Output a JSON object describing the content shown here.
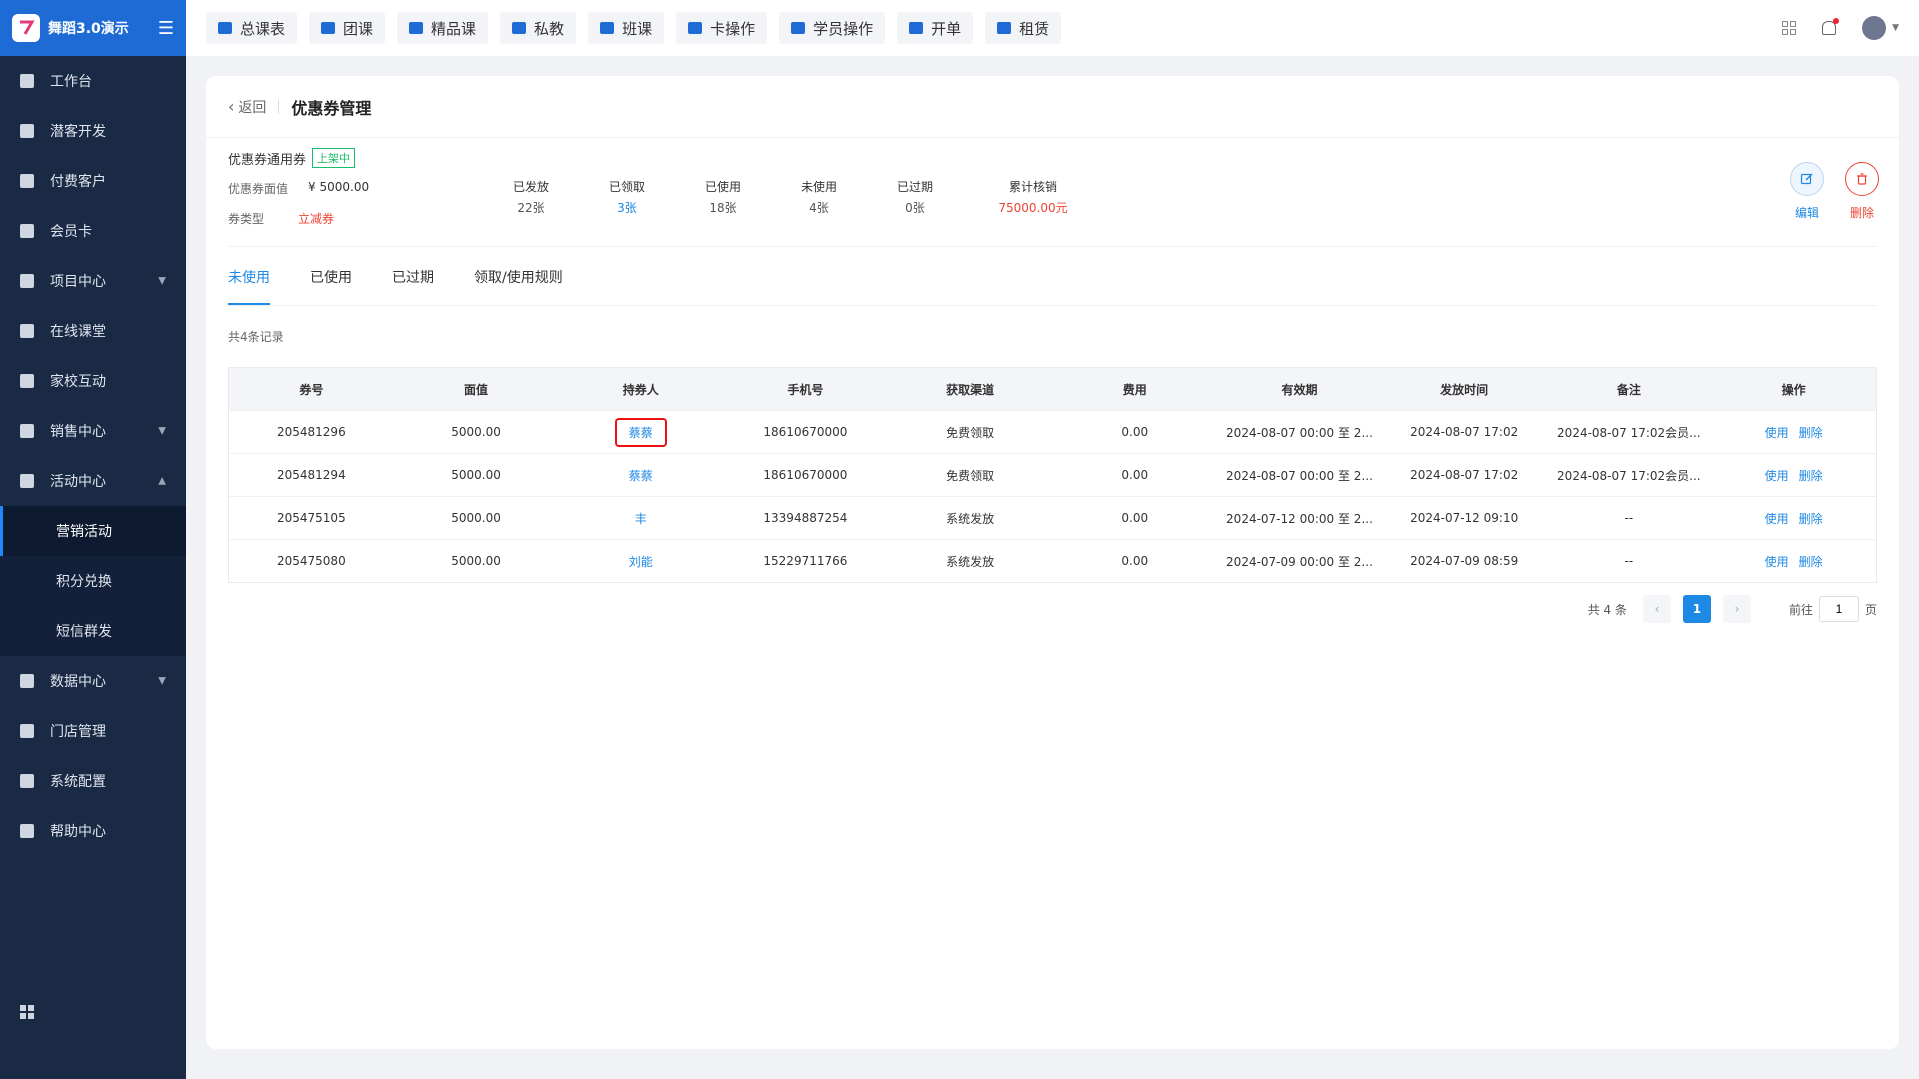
{
  "app": {
    "title": "舞蹈3.0演示"
  },
  "sidebar": {
    "items": [
      {
        "label": "工作台",
        "icon": "monitor-icon"
      },
      {
        "label": "潜客开发",
        "icon": "id-card-icon"
      },
      {
        "label": "付费客户",
        "icon": "users-icon"
      },
      {
        "label": "会员卡",
        "icon": "card-icon"
      },
      {
        "label": "项目中心",
        "icon": "folder-icon"
      },
      {
        "label": "在线课堂",
        "icon": "video-icon"
      },
      {
        "label": "家校互动",
        "icon": "book-icon"
      },
      {
        "label": "销售中心",
        "icon": "tag-icon"
      },
      {
        "label": "活动中心",
        "icon": "calendar-icon"
      }
    ],
    "sub_items": [
      {
        "label": "营销活动"
      },
      {
        "label": "积分兑换"
      },
      {
        "label": "短信群发"
      }
    ],
    "items_after": [
      {
        "label": "数据中心",
        "icon": "pie-chart-icon"
      },
      {
        "label": "门店管理",
        "icon": "store-icon"
      },
      {
        "label": "系统配置",
        "icon": "settings-icon"
      },
      {
        "label": "帮助中心",
        "icon": "help-icon"
      }
    ]
  },
  "topbar": {
    "tabs": [
      {
        "label": "总课表"
      },
      {
        "label": "团课"
      },
      {
        "label": "精品课"
      },
      {
        "label": "私教"
      },
      {
        "label": "班课"
      },
      {
        "label": "卡操作"
      },
      {
        "label": "学员操作"
      },
      {
        "label": "开单"
      },
      {
        "label": "租赁"
      }
    ]
  },
  "header": {
    "back_label": "返回",
    "title": "优惠券管理"
  },
  "coupon": {
    "name": "优惠券通用券",
    "status": "上架中",
    "value_label": "优惠券面值",
    "value": "¥ 5000.00",
    "type_label": "券类型",
    "type": "立减券",
    "stats": [
      {
        "label": "已发放",
        "value": "22张"
      },
      {
        "label": "已领取",
        "value": "3张"
      },
      {
        "label": "已使用",
        "value": "18张"
      },
      {
        "label": "未使用",
        "value": "4张"
      },
      {
        "label": "已过期",
        "value": "0张"
      },
      {
        "label": "累计核销",
        "value": "75000.00元"
      }
    ],
    "edit_label": "编辑",
    "delete_label": "删除"
  },
  "tabs": [
    {
      "label": "未使用"
    },
    {
      "label": "已使用"
    },
    {
      "label": "已过期"
    },
    {
      "label": "领取/使用规则"
    }
  ],
  "record_count": "共4条记录",
  "table": {
    "columns": [
      "券号",
      "面值",
      "持券人",
      "手机号",
      "获取渠道",
      "费用",
      "有效期",
      "发放时间",
      "备注",
      "操作"
    ],
    "rows": [
      {
        "code": "205481296",
        "value": "5000.00",
        "holder": "蔡蔡",
        "phone": "18610670000",
        "channel": "免费领取",
        "fee": "0.00",
        "validity": "2024-08-07 00:00 至 2...",
        "issued": "2024-08-07 17:02",
        "note": "2024-08-07 17:02会员..."
      },
      {
        "code": "205481294",
        "value": "5000.00",
        "holder": "蔡蔡",
        "phone": "18610670000",
        "channel": "免费领取",
        "fee": "0.00",
        "validity": "2024-08-07 00:00 至 2...",
        "issued": "2024-08-07 17:02",
        "note": "2024-08-07 17:02会员..."
      },
      {
        "code": "205475105",
        "value": "5000.00",
        "holder": "丰",
        "phone": "13394887254",
        "channel": "系统发放",
        "fee": "0.00",
        "validity": "2024-07-12 00:00 至 2...",
        "issued": "2024-07-12 09:10",
        "note": "--"
      },
      {
        "code": "205475080",
        "value": "5000.00",
        "holder": "刘能",
        "phone": "15229711766",
        "channel": "系统发放",
        "fee": "0.00",
        "validity": "2024-07-09 00:00 至 2...",
        "issued": "2024-07-09 08:59",
        "note": "--"
      }
    ],
    "op_use": "使用",
    "op_delete": "删除"
  },
  "pagination": {
    "total": "共 4 条",
    "current": "1",
    "goto_label": "前往",
    "goto_value": "1",
    "page_unit": "页"
  }
}
